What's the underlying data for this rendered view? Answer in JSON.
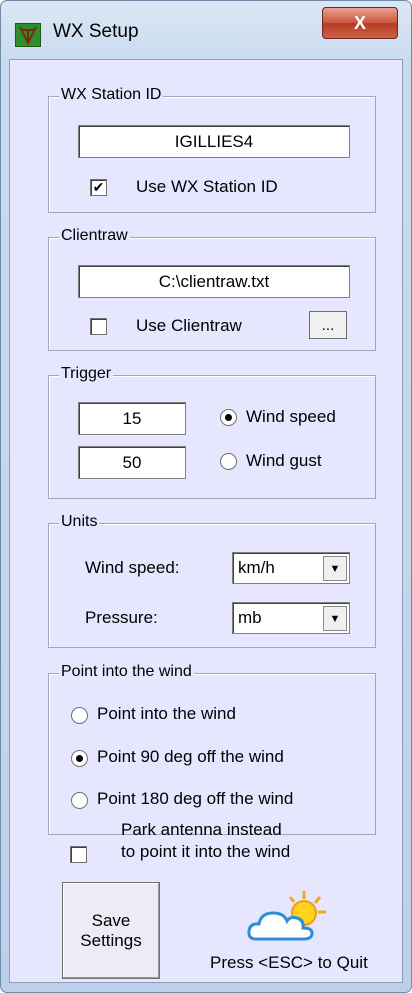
{
  "window": {
    "title": "WX Setup",
    "close_glyph": "X"
  },
  "station": {
    "group_label": "WX Station ID",
    "value": "IGILLIES4",
    "checkbox_label": "Use WX Station ID",
    "checked": true
  },
  "clientraw": {
    "group_label": "Clientraw",
    "value": "C:\\clientraw.txt",
    "checkbox_label": "Use Clientraw",
    "checked": false,
    "browse_label": "..."
  },
  "trigger": {
    "group_label": "Trigger",
    "speed_value": "15",
    "gust_value": "50",
    "speed_label": "Wind speed",
    "gust_label": "Wind gust",
    "selected": "Wind speed"
  },
  "units": {
    "group_label": "Units",
    "wind_label": "Wind speed:",
    "wind_value": "km/h",
    "pressure_label": "Pressure:",
    "pressure_value": "mb"
  },
  "point": {
    "group_label": "Point into the wind",
    "options": [
      "Point into the wind",
      "Point 90 deg off the wind",
      "Point 180 deg off the wind"
    ],
    "selected_index": 1
  },
  "park": {
    "line1": "Park antenna instead",
    "line2": "to point it into the wind",
    "checked": false
  },
  "save": {
    "line1": "Save",
    "line2": "Settings"
  },
  "footer": {
    "hint": "Press <ESC> to Quit"
  },
  "icons": {
    "app": "antenna-icon",
    "weather": "partly-sunny-cloud-icon"
  },
  "colors": {
    "client_bg": "#e6e6ff",
    "close_button": "#c8553d"
  }
}
